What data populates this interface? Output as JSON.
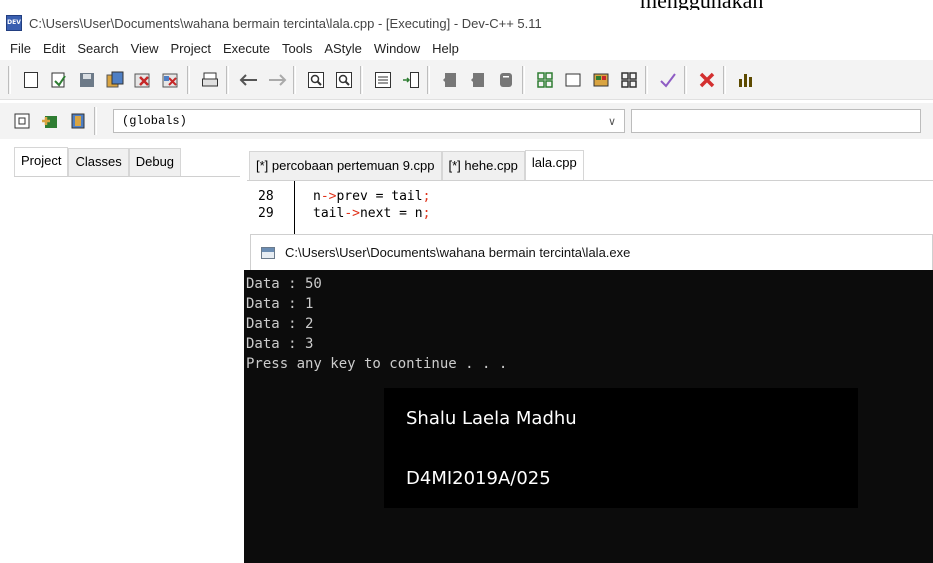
{
  "window": {
    "title": "C:\\Users\\User\\Documents\\wahana bermain tercinta\\lala.cpp - [Executing] - Dev-C++ 5.11",
    "app_icon_text": "DEV"
  },
  "menu": [
    "File",
    "Edit",
    "Search",
    "View",
    "Project",
    "Execute",
    "Tools",
    "AStyle",
    "Window",
    "Help"
  ],
  "toolbar": {
    "icons": [
      "new-file-icon",
      "open-file-icon",
      "save-icon",
      "save-all-icon",
      "close-icon",
      "close-all-icon",
      "print-icon",
      "undo-icon",
      "redo-icon",
      "find-icon",
      "replace-icon",
      "indent-icon",
      "unindent-icon",
      "bookmark-icon",
      "bookmark-next-icon",
      "bookmark-prev-icon",
      "compile-icon",
      "run-icon",
      "compile-run-icon",
      "rebuild-icon",
      "check-icon",
      "stop-icon",
      "chart-icon"
    ]
  },
  "toolbar2": {
    "globals_value": "(globals)"
  },
  "left_panel": {
    "tabs": [
      "Project",
      "Classes",
      "Debug"
    ],
    "active_tab": "Project"
  },
  "editor": {
    "tabs": [
      "[*] percobaan pertemuan 9.cpp",
      "[*] hehe.cpp",
      "lala.cpp"
    ],
    "active_tab": "lala.cpp",
    "lines": [
      {
        "num": "28",
        "lhs": "n",
        "op1": "->",
        "mid": "prev = tail",
        "end": ";"
      },
      {
        "num": "29",
        "lhs": "tail",
        "op1": "->",
        "mid": "next = n",
        "end": ";"
      }
    ]
  },
  "console": {
    "title": "C:\\Users\\User\\Documents\\wahana bermain tercinta\\lala.exe",
    "lines": [
      "Data : 50",
      "Data : 1",
      "Data : 2",
      "Data : 3",
      "Press any key to continue . . ."
    ]
  },
  "caption": {
    "name": "Shalu Laela Madhu",
    "id": "D4MI2019A/025"
  }
}
